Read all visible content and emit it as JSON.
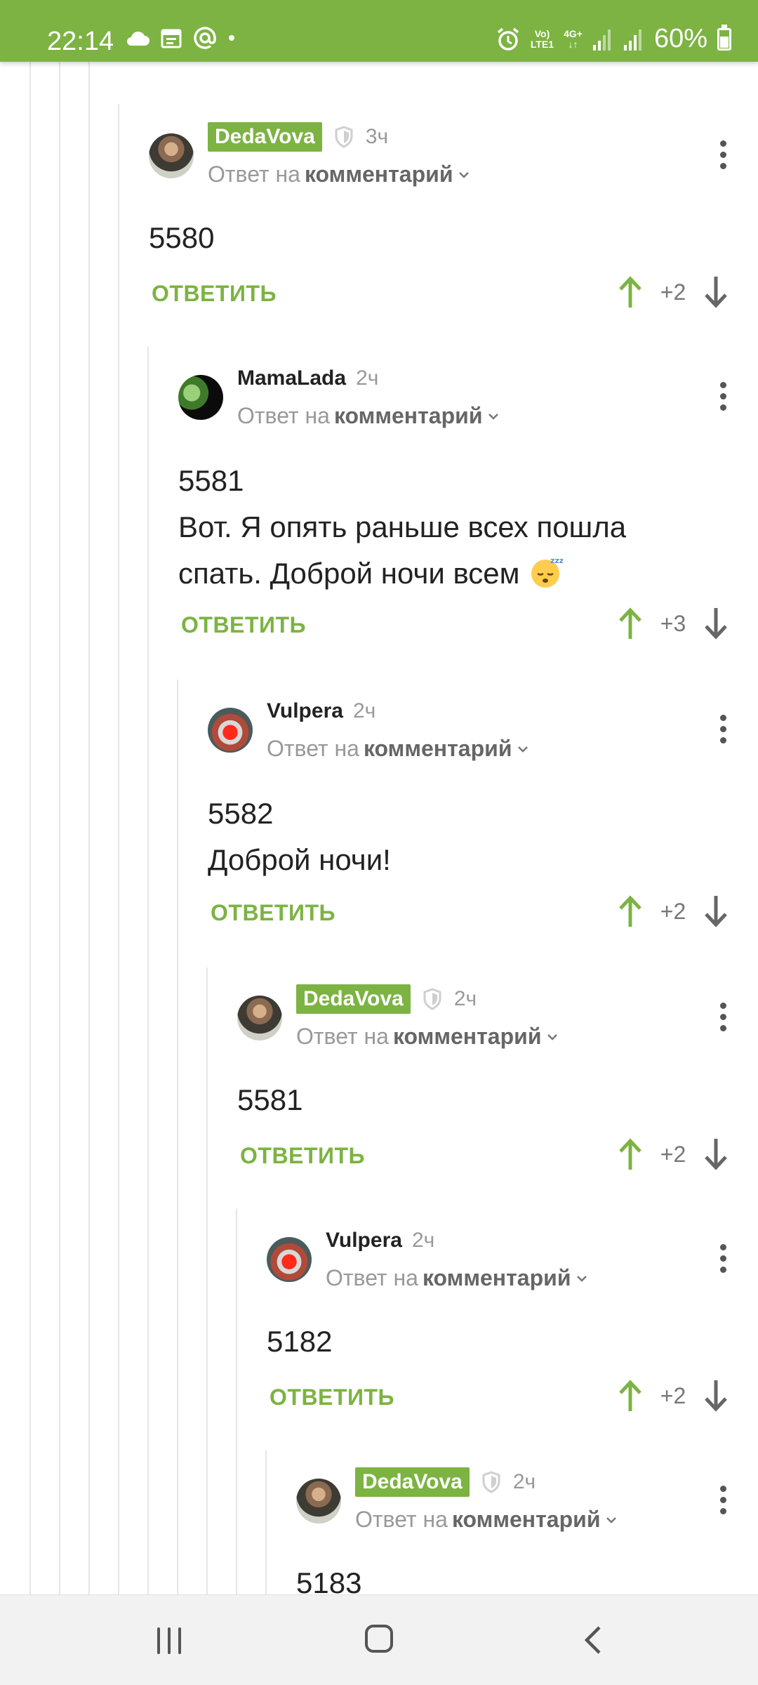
{
  "status_bar": {
    "time": "22:14",
    "left_icons": [
      "cloud-icon",
      "calendar-icon",
      "at-icon",
      "dot-icon"
    ],
    "network_top": "Vo)",
    "network_bottom": "LTE1",
    "network2": "4G+",
    "battery": "60%"
  },
  "comments": [
    {
      "author": "DedaVova",
      "badge": true,
      "age": "3ч",
      "reply_prefix": "Ответ на",
      "reply_target": "комментарий",
      "lines": [
        "5580"
      ],
      "reply_label": "ОТВЕТИТЬ",
      "score": "+2"
    },
    {
      "author": "MamaLada",
      "badge": false,
      "age": "2ч",
      "reply_prefix": "Ответ на",
      "reply_target": "комментарий",
      "lines": [
        "5581",
        "Вот. Я опять раньше всех пошла",
        "спать. Доброй ночи всем"
      ],
      "emoji": "sleeping-face-emoji",
      "reply_label": "ОТВЕТИТЬ",
      "score": "+3"
    },
    {
      "author": "Vulpera",
      "badge": false,
      "age": "2ч",
      "reply_prefix": "Ответ на",
      "reply_target": "комментарий",
      "lines": [
        "5582",
        "Доброй ночи!"
      ],
      "reply_label": "ОТВЕТИТЬ",
      "score": "+2"
    },
    {
      "author": "DedaVova",
      "badge": true,
      "age": "2ч",
      "reply_prefix": "Ответ на",
      "reply_target": "комментарий",
      "lines": [
        "5581"
      ],
      "reply_label": "ОТВЕТИТЬ",
      "score": "+2"
    },
    {
      "author": "Vulpera",
      "badge": false,
      "age": "2ч",
      "reply_prefix": "Ответ на",
      "reply_target": "комментарий",
      "lines": [
        "5182"
      ],
      "reply_label": "ОТВЕТИТЬ",
      "score": "+2"
    },
    {
      "author": "DedaVova",
      "badge": true,
      "age": "2ч",
      "reply_prefix": "Ответ на",
      "reply_target": "комментарий",
      "lines": [
        "5183"
      ]
    }
  ],
  "colors": {
    "accent": "#7cb342",
    "muted": "#999999"
  }
}
